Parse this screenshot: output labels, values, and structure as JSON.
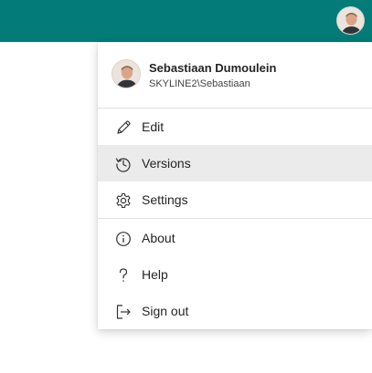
{
  "header": {
    "color": "#027b79",
    "avatar_icon": "user-avatar"
  },
  "account": {
    "name": "Sebastiaan Dumoulein",
    "login": "SKYLINE2\\Sebastiaan"
  },
  "menu": {
    "items": [
      {
        "label": "Edit",
        "icon": "pencil-icon"
      },
      {
        "label": "Versions",
        "icon": "history-icon",
        "active": true
      },
      {
        "label": "Settings",
        "icon": "gear-icon"
      },
      {
        "label": "About",
        "icon": "info-icon"
      },
      {
        "label": "Help",
        "icon": "question-icon"
      },
      {
        "label": "Sign out",
        "icon": "sign-out-icon"
      }
    ],
    "hover_color": "#ebebeb"
  }
}
